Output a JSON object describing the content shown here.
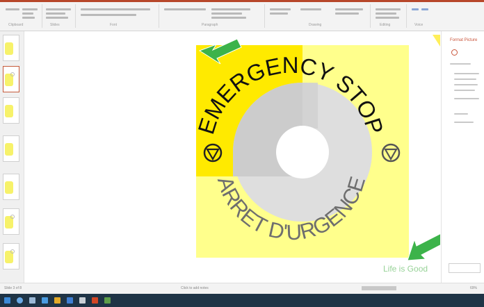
{
  "ribbon": {
    "groups": [
      "Clipboard",
      "Slides",
      "Font",
      "Paragraph",
      "Drawing",
      "Editing",
      "Voice"
    ]
  },
  "slide": {
    "top_text": "EMERGENCY STOP",
    "bottom_text": "ARRET D'URGENCE",
    "watermark": "Life is Good"
  },
  "pane": {
    "title": "Format Picture"
  },
  "status": {
    "slide_info": "Slide 3 of 8",
    "notes_label": "Click to add notes",
    "zoom": "69%"
  },
  "colors": {
    "bright_yellow": "#ffea00",
    "pale_yellow": "#ffff8c",
    "gray": "#cccccc",
    "light_gray": "#dedede",
    "arrow_green": "#3cb34a"
  }
}
